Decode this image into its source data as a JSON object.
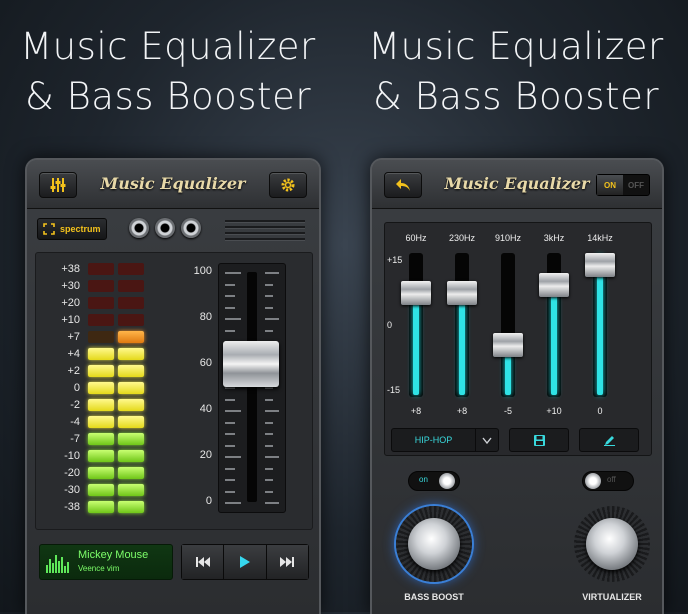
{
  "headline": {
    "left_line1": "Music Equalizer",
    "left_line2": "& Bass Booster",
    "right_line1": "Music Equalizer",
    "right_line2": "& Bass Booster"
  },
  "left_phone": {
    "title": "Music Equalizer",
    "settings_icon": "gear-icon",
    "eq_icon": "equalizer-sliders-icon",
    "spectrum_label": "spectrum",
    "db_labels": [
      "+38",
      "+30",
      "+20",
      "+10",
      "+7",
      "+4",
      "+2",
      "0",
      "-2",
      "-4",
      "-7",
      "-10",
      "-20",
      "-30",
      "-38"
    ],
    "scale_labels": [
      "100",
      "80",
      "60",
      "40",
      "20",
      "0"
    ],
    "volume_percent": 60,
    "now_playing": {
      "title": "Mickey Mouse",
      "artist": "Veence vim"
    },
    "controls": [
      "previous-icon",
      "play-icon",
      "next-icon"
    ]
  },
  "right_phone": {
    "title": "Music Equalizer",
    "back_icon": "back-arrow-icon",
    "power_toggle": {
      "on_label": "ON",
      "off_label": "OFF",
      "state": "on"
    },
    "axis": {
      "top": "+15",
      "mid": "0",
      "bottom": "-15"
    },
    "bands": [
      {
        "freq": "60Hz",
        "value": "+8",
        "level": 8
      },
      {
        "freq": "230Hz",
        "value": "+8",
        "level": 8
      },
      {
        "freq": "910Hz",
        "value": "-5",
        "level": -5
      },
      {
        "freq": "3kHz",
        "value": "+10",
        "level": 10
      },
      {
        "freq": "14kHz",
        "value": "0",
        "level": 15
      }
    ],
    "preset": {
      "name": "HIP-HOP"
    },
    "bass_boost": {
      "label": "BASS BOOST",
      "toggle": "on"
    },
    "virtualizer": {
      "label": "VIRTUALIZER",
      "toggle": "off"
    },
    "colors": {
      "accent": "#2fe3e6",
      "brand_gold": "#f3c21c"
    }
  }
}
